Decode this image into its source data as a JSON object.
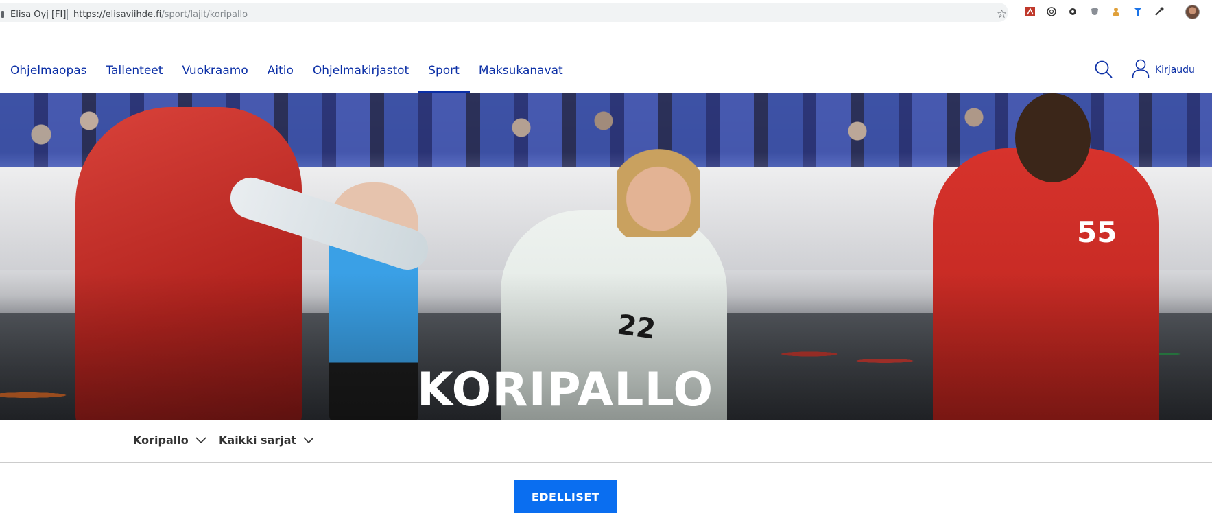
{
  "browser": {
    "site_identity": "Elisa Oyj [FI]",
    "url_domain": "https://elisaviihde.fi",
    "url_path": "/sport/lajit/koripallo"
  },
  "nav": {
    "items": [
      {
        "label": "Ohjelmaopas"
      },
      {
        "label": "Tallenteet"
      },
      {
        "label": "Vuokraamo"
      },
      {
        "label": "Aitio"
      },
      {
        "label": "Ohjelmakirjastot"
      },
      {
        "label": "Sport",
        "active": true
      },
      {
        "label": "Maksukanavat"
      }
    ],
    "login_label": "Kirjaudu"
  },
  "hero": {
    "title": "KORIPALLO",
    "jersey_right": "55",
    "jersey_mid": "22"
  },
  "filters": {
    "sport": "Koripallo",
    "series": "Kaikki sarjat"
  },
  "actions": {
    "previous_label": "EDELLISET"
  },
  "colors": {
    "nav_blue": "#0b2fa6",
    "button_blue": "#0a6ef0"
  }
}
